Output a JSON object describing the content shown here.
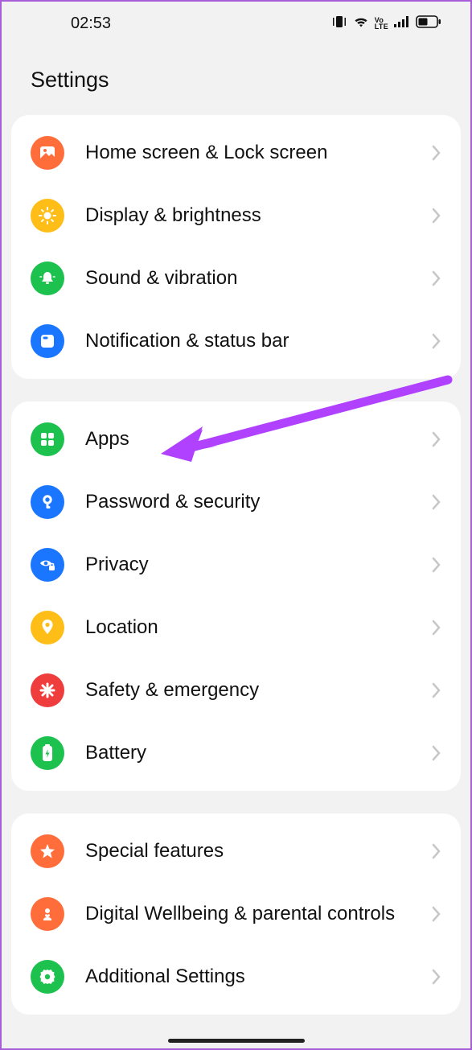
{
  "status": {
    "time": "02:53",
    "volte": "Vo LTE"
  },
  "header": {
    "title": "Settings"
  },
  "groups": [
    {
      "items": [
        {
          "label": "Home screen & Lock screen",
          "icon": "picture-icon",
          "color": "c-orange"
        },
        {
          "label": "Display & brightness",
          "icon": "sun-icon",
          "color": "c-yellow"
        },
        {
          "label": "Sound & vibration",
          "icon": "bell-icon",
          "color": "c-green"
        },
        {
          "label": "Notification & status bar",
          "icon": "notif-icon",
          "color": "c-blue"
        }
      ]
    },
    {
      "items": [
        {
          "label": "Apps",
          "icon": "grid-icon",
          "color": "c-green"
        },
        {
          "label": "Password & security",
          "icon": "key-icon",
          "color": "c-blue"
        },
        {
          "label": "Privacy",
          "icon": "eye-lock-icon",
          "color": "c-blue"
        },
        {
          "label": "Location",
          "icon": "pin-icon",
          "color": "c-yellow"
        },
        {
          "label": "Safety & emergency",
          "icon": "asterisk-icon",
          "color": "c-red"
        },
        {
          "label": "Battery",
          "icon": "battery-icon",
          "color": "c-green"
        }
      ]
    },
    {
      "items": [
        {
          "label": "Special features",
          "icon": "star-icon",
          "color": "c-orange"
        },
        {
          "label": "Digital Wellbeing & parental controls",
          "icon": "heart-person-icon",
          "color": "c-orange"
        },
        {
          "label": "Additional Settings",
          "icon": "gear-icon",
          "color": "c-green"
        }
      ]
    }
  ]
}
